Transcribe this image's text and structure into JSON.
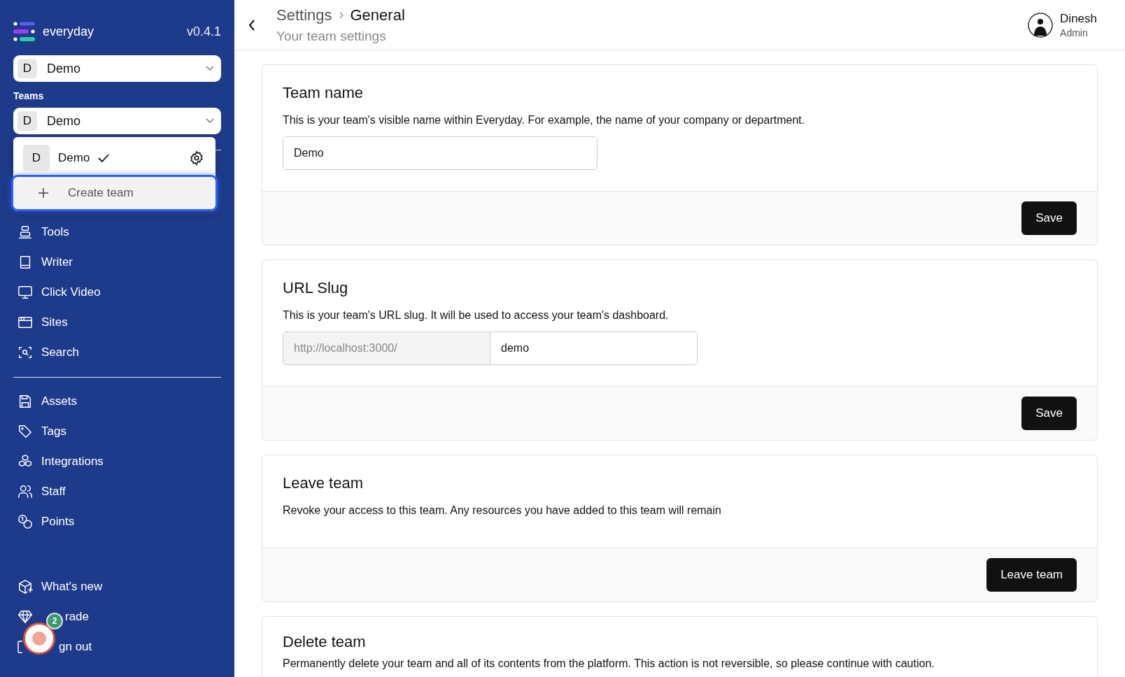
{
  "sidebar": {
    "brand": "everyday",
    "version": "v0.4.1",
    "workspace_select": {
      "initial": "D",
      "value": "Demo"
    },
    "teams_label": "Teams",
    "team_select": {
      "initial": "D",
      "value": "Demo"
    },
    "team_menu": {
      "items": [
        {
          "kind": "team",
          "initial": "D",
          "label": "Demo",
          "selected": true,
          "focused": false
        },
        {
          "kind": "action",
          "label": "Create team",
          "selected": false,
          "focused": true
        }
      ]
    },
    "nav_main": [
      {
        "label": "Tools"
      },
      {
        "label": "Writer"
      },
      {
        "label": "Click Video"
      },
      {
        "label": "Sites"
      },
      {
        "label": "Search"
      }
    ],
    "nav_secondary": [
      {
        "label": "Assets"
      },
      {
        "label": "Tags"
      },
      {
        "label": "Integrations"
      },
      {
        "label": "Staff"
      },
      {
        "label": "Points"
      }
    ],
    "nav_footer": [
      {
        "label": "What's new"
      },
      {
        "label": "rade"
      },
      {
        "label": "gn out"
      }
    ]
  },
  "header": {
    "breadcrumb": [
      "Settings",
      "General"
    ],
    "subtitle": "Your team settings",
    "user": {
      "name": "Dinesh",
      "role": "Admin"
    }
  },
  "cards": [
    {
      "kind": "text_field",
      "title": "Team name",
      "description": "This is your team's visible name within Everyday. For example, the name of your company or department.",
      "value": "Demo",
      "button": "Save"
    },
    {
      "kind": "slug",
      "title": "URL Slug",
      "description": "This is your team's URL slug. It will be used to access your team's dashboard.",
      "prefix": "http://localhost:3000/",
      "value": "demo",
      "button": "Save"
    },
    {
      "kind": "plain",
      "title": "Leave team",
      "description": "Revoke your access to this team. Any resources you have added to this team will remain",
      "button": "Leave team"
    },
    {
      "kind": "plain",
      "title": "Delete team",
      "description": "Permanently delete your team and all of its contents from the platform. This action is not reversible, so please continue with caution."
    }
  ],
  "chat_widget": {
    "badge": "2"
  }
}
